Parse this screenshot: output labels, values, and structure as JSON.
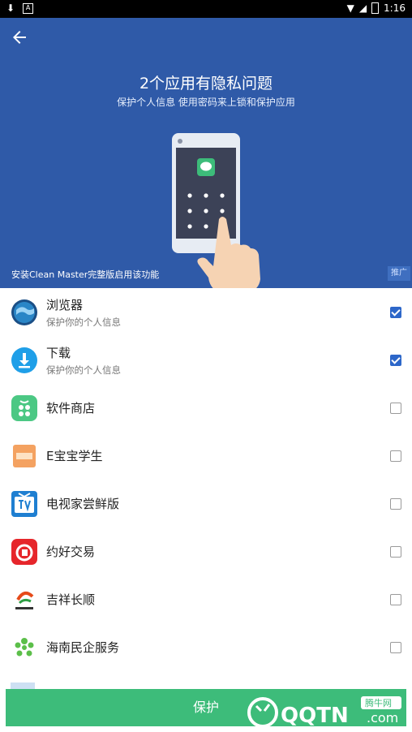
{
  "status_bar": {
    "time": "1:16"
  },
  "hero": {
    "title": "2个应用有隐私问题",
    "subtitle": "保护个人信息 使用密码来上锁和保护应用",
    "install_text": "安装Clean Master完整版启用该功能",
    "ad_badge": "推广"
  },
  "apps": [
    {
      "name": "浏览器",
      "desc": "保护你的个人信息",
      "checked": true,
      "icon": "globe-icon"
    },
    {
      "name": "下载",
      "desc": "保护你的个人信息",
      "checked": true,
      "icon": "download-icon"
    },
    {
      "name": "软件商店",
      "desc": "",
      "checked": false,
      "icon": "store-icon"
    },
    {
      "name": "E宝宝学生",
      "desc": "",
      "checked": false,
      "icon": "ebaobao-icon"
    },
    {
      "name": "电视家尝鲜版",
      "desc": "",
      "checked": false,
      "icon": "tv-icon"
    },
    {
      "name": "约好交易",
      "desc": "",
      "checked": false,
      "icon": "yuehao-icon"
    },
    {
      "name": "吉祥长顺",
      "desc": "",
      "checked": false,
      "icon": "jixiang-icon"
    },
    {
      "name": "海南民企服务",
      "desc": "",
      "checked": false,
      "icon": "hainan-icon"
    }
  ],
  "bottom": {
    "protect_label": "保护"
  },
  "watermark": {
    "brand": "QQTN",
    "suffix": ".com",
    "badge": "腾牛网"
  },
  "colors": {
    "hero_bg": "#2f5aa8",
    "accent": "#2d67c9",
    "protect_bg": "#3dbc7a"
  }
}
